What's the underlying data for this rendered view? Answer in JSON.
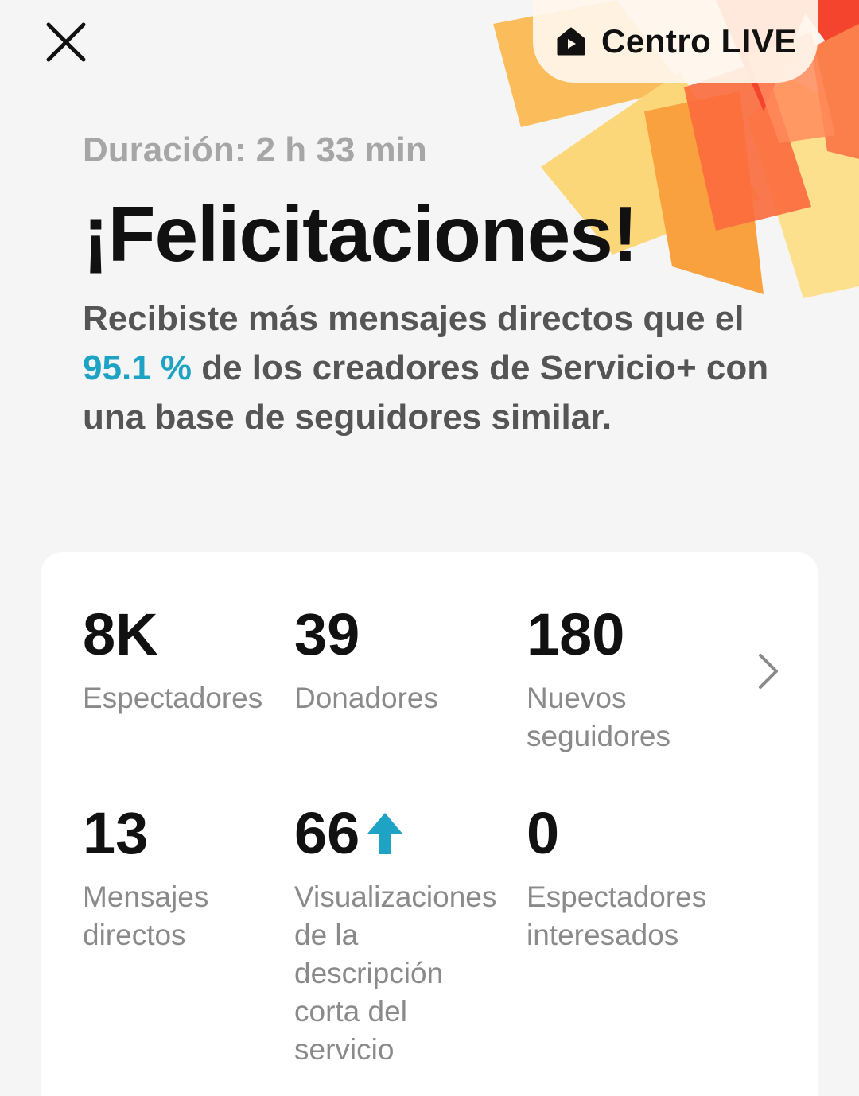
{
  "header": {
    "close_icon": "close-icon",
    "live_center": {
      "icon": "live-home-icon",
      "label": "Centro LIVE"
    }
  },
  "summary": {
    "duration": "Duración: 2 h 33 min",
    "headline": "¡Felicitaciones!",
    "message_part1": "Recibiste más mensajes directos que el ",
    "message_highlight": "95.1 %",
    "message_part2": " de los creadores de Servicio+ con una base de seguidores similar."
  },
  "stats": [
    {
      "value": "8K",
      "label": "Espectadores"
    },
    {
      "value": "39",
      "label": "Donadores"
    },
    {
      "value": "180",
      "label": "Nuevos seguidores"
    },
    {
      "value": "13",
      "label": "Mensajes directos"
    },
    {
      "value": "66",
      "label": "Visualizaciones de la descripción corta del servicio",
      "trend": "up"
    },
    {
      "value": "0",
      "label": "Espectadores interesados"
    }
  ],
  "colors": {
    "accent": "#1ea3c5",
    "background": "#f5f5f5",
    "card": "#ffffff",
    "burst_red": "#f5442e",
    "burst_orange": "#f7a03d",
    "burst_yellow": "#fcd77a"
  }
}
